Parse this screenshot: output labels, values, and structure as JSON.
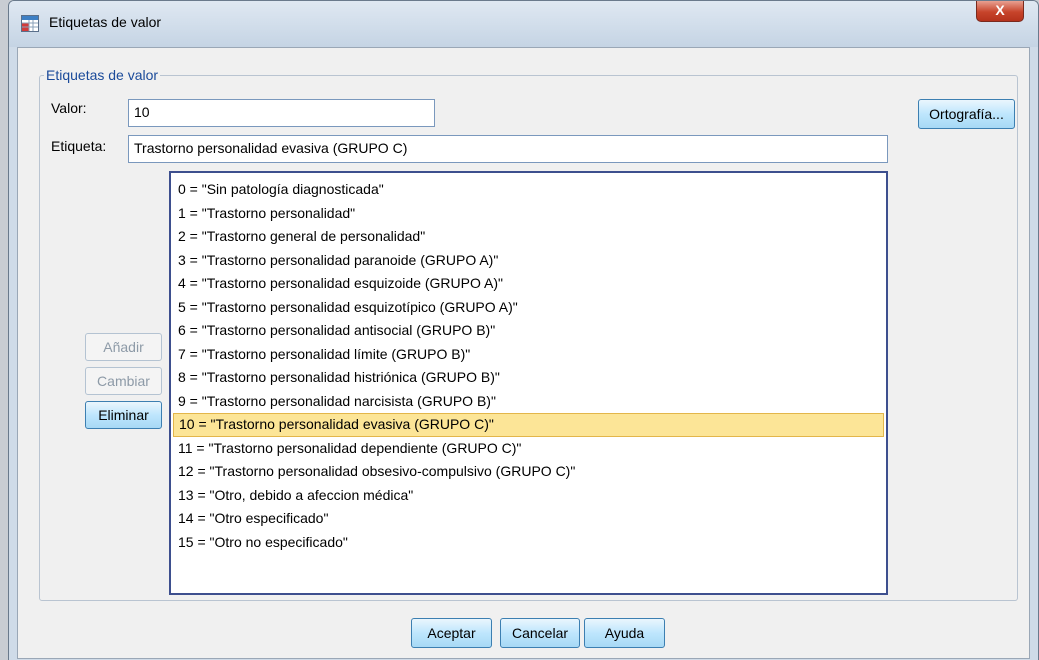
{
  "window": {
    "title": "Etiquetas de valor",
    "close_label": "X"
  },
  "group": {
    "legend": "Etiquetas de valor"
  },
  "form": {
    "valor_label": "Valor:",
    "valor_value": "10",
    "etiqueta_label": "Etiqueta:",
    "etiqueta_value": "Trastorno personalidad evasiva (GRUPO C)"
  },
  "buttons": {
    "ortografia": "Ortografía...",
    "anadir": "Añadir",
    "cambiar": "Cambiar",
    "eliminar": "Eliminar",
    "aceptar": "Aceptar",
    "cancelar": "Cancelar",
    "ayuda": "Ayuda"
  },
  "list": {
    "selected_index": 10,
    "items": [
      "0 = \"Sin patología diagnosticada\"",
      "1 = \"Trastorno personalidad\"",
      "2 = \"Trastorno general de personalidad\"",
      "3 = \"Trastorno personalidad paranoide (GRUPO A)\"",
      "4 = \"Trastorno personalidad esquizoide (GRUPO A)\"",
      "5 = \"Trastorno personalidad esquizotípico (GRUPO A)\"",
      "6 = \"Trastorno personalidad antisocial (GRUPO B)\"",
      "7 = \"Trastorno personalidad límite (GRUPO B)\"",
      "8 = \"Trastorno personalidad histriónica (GRUPO B)\"",
      "9 = \"Trastorno personalidad narcisista (GRUPO B)\"",
      "10 = \"Trastorno personalidad evasiva (GRUPO C)\"",
      "11 = \"Trastorno personalidad dependiente (GRUPO C)\"",
      "12 = \"Trastorno personalidad obsesivo-compulsivo (GRUPO C)\"",
      "13 = \"Otro, debido a afeccion médica\"",
      "14 = \"Otro especificado\"",
      "15 = \"Otro no especificado\""
    ]
  },
  "colors": {
    "selection_fill": "#fce597",
    "selection_border": "#e3b64a",
    "legend_text": "#1a4a9a"
  }
}
